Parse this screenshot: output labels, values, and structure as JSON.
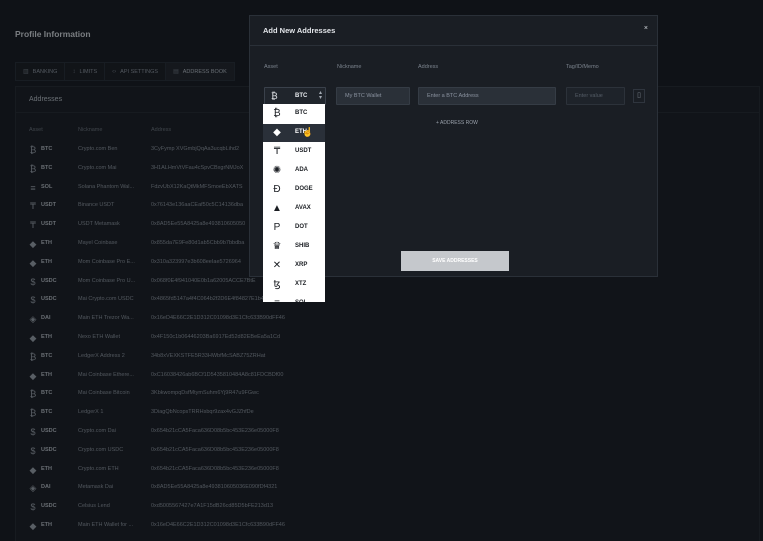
{
  "page": {
    "title": "Profile Information",
    "tabs": [
      {
        "label": "BANKING",
        "icon": "bank-icon"
      },
      {
        "label": "LIMITS",
        "icon": "limits-icon"
      },
      {
        "label": "API SETTINGS",
        "icon": "code-icon"
      },
      {
        "label": "ADDRESS BOOK",
        "icon": "book-icon"
      }
    ],
    "panel_title": "Addresses",
    "columns": {
      "asset": "Asset",
      "nickname": "Nickname",
      "address": "Address"
    },
    "rows": [
      {
        "icon": "₿",
        "symbol": "BTC",
        "nickname": "Crypto.com Ben",
        "address": "3CyFymp XVGmbjQqAa3ucqbLihd2"
      },
      {
        "icon": "₿",
        "symbol": "BTC",
        "nickname": "Crypto.com Mai",
        "address": "3H1ALHmVtVFau4cSpvCBxgrNMJoX"
      },
      {
        "icon": "≡",
        "symbol": "SOL",
        "nickname": "Solana Phantom Wal...",
        "address": "FdzvUbX12KaQtMkMFSmoeEbXATS"
      },
      {
        "icon": "₸",
        "symbol": "USDT",
        "nickname": "Binance USDT",
        "address": "0x76143e136aaCEaf50c5C14136dba"
      },
      {
        "icon": "₸",
        "symbol": "USDT",
        "nickname": "USDT Metamask",
        "address": "0x8AD5Ee55A8425a8e493810605050"
      },
      {
        "icon": "◆",
        "symbol": "ETH",
        "nickname": "Mayel Coinbase",
        "address": "0x855da7E9Fe80d1ab5Cbb9b7bbdba"
      },
      {
        "icon": "◆",
        "symbol": "ETH",
        "nickname": "Mom Coinbase Pro E...",
        "address": "0x310a323997e3b608eeIae5726964"
      },
      {
        "icon": "$",
        "symbol": "USDC",
        "nickname": "Mom Coinbase Pro U...",
        "address": "0x068f0E4f941040E0b1a62005ACCE7BtE"
      },
      {
        "icon": "$",
        "symbol": "USDC",
        "nickname": "Mai Crypto.com USDC",
        "address": "0x4865fd5147a4f4C064b2f2D6E4f84827E1b4E6Df"
      },
      {
        "icon": "◈",
        "symbol": "DAI",
        "nickname": "Main ETH Trezor Wa...",
        "address": "0x16eD4E66C2E1D312C01098d3E1Cfc633B90dFF46"
      },
      {
        "icon": "◆",
        "symbol": "ETH",
        "nickname": "Nexo ETH Wallet",
        "address": "0x4F150c1b06446203Ba6917Ed52d82EBeEa5a1Cd"
      },
      {
        "icon": "₿",
        "symbol": "BTC",
        "nickname": "LedgerX Address 2",
        "address": "34b8xVEXKSTFE5R33HWbfMcSABZ75ZRHat"
      },
      {
        "icon": "◆",
        "symbol": "ETH",
        "nickname": "Mai Coinbase Ethere...",
        "address": "0xC16038426ab6BCf1D5435810484A8c81FDCBDf00"
      },
      {
        "icon": "₿",
        "symbol": "BTC",
        "nickname": "Mai Coinbase Bitcoin",
        "address": "3KbkwompqDsfMtymSuhm6Yj9R47u9FGwc"
      },
      {
        "icon": "₿",
        "symbol": "BTC",
        "nickname": "LedgerX 1",
        "address": "3DiagQbNcopsTRRHsbqr9zax4vGJZhfDe"
      },
      {
        "icon": "$",
        "symbol": "USDC",
        "nickname": "Crypto.com Dai",
        "address": "0x654b21cCA5Faca636D08b5bc453E236e05000F8"
      },
      {
        "icon": "$",
        "symbol": "USDC",
        "nickname": "Crypto.com USDC",
        "address": "0x654b21cCA5Faca636D08b5bc453E236e05000F8"
      },
      {
        "icon": "◆",
        "symbol": "ETH",
        "nickname": "Crypto.com ETH",
        "address": "0x654b21cCA5Faca636D08b5bc453E236e05000F8"
      },
      {
        "icon": "◈",
        "symbol": "DAI",
        "nickname": "Metamask Dai",
        "address": "0x8AD5Ee55A8425a8e493810605036E090fDf4321"
      },
      {
        "icon": "$",
        "symbol": "USDC",
        "nickname": "Celsius Lend",
        "address": "0xd5005567427e7A1F15dB26cd85D5bFE213d13"
      },
      {
        "icon": "◆",
        "symbol": "ETH",
        "nickname": "Main ETH Wallet for ...",
        "address": "0x16eD4E66C2E1D312C01098d3E1Cfc633B90dFF46"
      }
    ]
  },
  "modal": {
    "title": "Add New Addresses",
    "close": "×",
    "headers": {
      "asset": "Asset",
      "nickname": "Nickname",
      "address": "Address",
      "tag": "Tag/ID/Memo"
    },
    "selected_asset": "BTC",
    "nickname_placeholder": "My BTC Wallet",
    "address_placeholder": "Enter a BTC Address",
    "tag_placeholder": "Enter value",
    "add_row": "+ ADDRESS ROW",
    "save": "SAVE ADDRESSES"
  },
  "dropdown": {
    "options": [
      {
        "icon": "₿",
        "label": "BTC",
        "active": false
      },
      {
        "icon": "◆",
        "label": "ETH",
        "active": true
      },
      {
        "icon": "₸",
        "label": "USDT",
        "active": false
      },
      {
        "icon": "✺",
        "label": "ADA",
        "active": false
      },
      {
        "icon": "Ð",
        "label": "DOGE",
        "active": false
      },
      {
        "icon": "▲",
        "label": "AVAX",
        "active": false
      },
      {
        "icon": "P",
        "label": "DOT",
        "active": false
      },
      {
        "icon": "♛",
        "label": "SHIB",
        "active": false
      },
      {
        "icon": "✕",
        "label": "XRP",
        "active": false
      },
      {
        "icon": "ꜩ",
        "label": "XTZ",
        "active": false
      },
      {
        "icon": "≡",
        "label": "SOL",
        "active": false
      }
    ]
  },
  "colors": {
    "background": "#15191f",
    "modal": "#1a1e24",
    "active_option": "#2a3039",
    "save_button": "#c5c8cc"
  }
}
